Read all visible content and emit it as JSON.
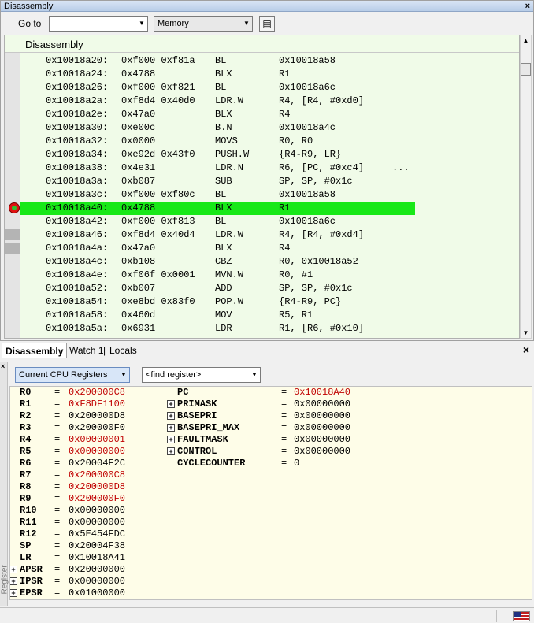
{
  "disassembly_window": {
    "title": "Disassembly",
    "close_glyph": "×",
    "toolbar": {
      "goto_label": "Go to",
      "goto_value": "",
      "memory_select": "Memory",
      "doc_button_icon": "document-icon"
    },
    "header": "Disassembly",
    "lines": [
      {
        "addr": "0x10018a20:",
        "op": "0xf000 0xf81a",
        "mn": "BL",
        "arg": "0x10018a58",
        "extra": ""
      },
      {
        "addr": "0x10018a24:",
        "op": "0x4788",
        "mn": "BLX",
        "arg": "R1",
        "extra": ""
      },
      {
        "addr": "0x10018a26:",
        "op": "0xf000 0xf821",
        "mn": "BL",
        "arg": "0x10018a6c",
        "extra": ""
      },
      {
        "addr": "0x10018a2a:",
        "op": "0xf8d4 0x40d0",
        "mn": "LDR.W",
        "arg": "R4, [R4, #0xd0]",
        "extra": ""
      },
      {
        "addr": "0x10018a2e:",
        "op": "0x47a0",
        "mn": "BLX",
        "arg": "R4",
        "extra": ""
      },
      {
        "addr": "0x10018a30:",
        "op": "0xe00c",
        "mn": "B.N",
        "arg": "0x10018a4c",
        "extra": ""
      },
      {
        "addr": "0x10018a32:",
        "op": "0x0000",
        "mn": "MOVS",
        "arg": "R0, R0",
        "extra": ""
      },
      {
        "addr": "0x10018a34:",
        "op": "0xe92d 0x43f0",
        "mn": "PUSH.W",
        "arg": "{R4-R9, LR}",
        "extra": ""
      },
      {
        "addr": "0x10018a38:",
        "op": "0x4e31",
        "mn": "LDR.N",
        "arg": "R6, [PC, #0xc4]",
        "extra": "..."
      },
      {
        "addr": "0x10018a3a:",
        "op": "0xb087",
        "mn": "SUB",
        "arg": "SP, SP, #0x1c",
        "extra": ""
      },
      {
        "addr": "0x10018a3c:",
        "op": "0xf000 0xf80c",
        "mn": "BL",
        "arg": "0x10018a58",
        "extra": ""
      },
      {
        "addr": "0x10018a40:",
        "op": "0x4788",
        "mn": "BLX",
        "arg": "R1",
        "extra": "",
        "current": true
      },
      {
        "addr": "0x10018a42:",
        "op": "0xf000 0xf813",
        "mn": "BL",
        "arg": "0x10018a6c",
        "extra": ""
      },
      {
        "addr": "0x10018a46:",
        "op": "0xf8d4 0x40d4",
        "mn": "LDR.W",
        "arg": "R4, [R4, #0xd4]",
        "extra": ""
      },
      {
        "addr": "0x10018a4a:",
        "op": "0x47a0",
        "mn": "BLX",
        "arg": "R4",
        "extra": ""
      },
      {
        "addr": "0x10018a4c:",
        "op": "0xb108",
        "mn": "CBZ",
        "arg": "R0, 0x10018a52",
        "extra": ""
      },
      {
        "addr": "0x10018a4e:",
        "op": "0xf06f 0x0001",
        "mn": "MVN.W",
        "arg": "R0, #1",
        "extra": ""
      },
      {
        "addr": "0x10018a52:",
        "op": "0xb007",
        "mn": "ADD",
        "arg": "SP, SP, #0x1c",
        "extra": ""
      },
      {
        "addr": "0x10018a54:",
        "op": "0xe8bd 0x83f0",
        "mn": "POP.W",
        "arg": "{R4-R9, PC}",
        "extra": ""
      },
      {
        "addr": "0x10018a58:",
        "op": "0x460d",
        "mn": "MOV",
        "arg": "R5, R1",
        "extra": ""
      },
      {
        "addr": "0x10018a5a:",
        "op": "0x6931",
        "mn": "LDR",
        "arg": "R1, [R6, #0x10]",
        "extra": ""
      }
    ]
  },
  "tabs": {
    "items": [
      "Disassembly",
      "Watch 1",
      "Locals"
    ],
    "active": "Disassembly",
    "separator": "|",
    "close_glyph": "×"
  },
  "register_window": {
    "side_close_glyph": "×",
    "side_label": "Register",
    "register_group_select": "Current CPU Registers",
    "find_register_placeholder": "<find register>",
    "left_registers": [
      {
        "name": "R0",
        "value": "0x200000C8",
        "changed": true
      },
      {
        "name": "R1",
        "value": "0xF8DF1100",
        "changed": true
      },
      {
        "name": "R2",
        "value": "0x200000D8",
        "changed": false
      },
      {
        "name": "R3",
        "value": "0x200000F0",
        "changed": false
      },
      {
        "name": "R4",
        "value": "0x00000001",
        "changed": true
      },
      {
        "name": "R5",
        "value": "0x00000000",
        "changed": true
      },
      {
        "name": "R6",
        "value": "0x20004F2C",
        "changed": false
      },
      {
        "name": "R7",
        "value": "0x200000C8",
        "changed": true
      },
      {
        "name": "R8",
        "value": "0x200000D8",
        "changed": true
      },
      {
        "name": "R9",
        "value": "0x200000F0",
        "changed": true
      },
      {
        "name": "R10",
        "value": "0x00000000",
        "changed": false
      },
      {
        "name": "R11",
        "value": "0x00000000",
        "changed": false
      },
      {
        "name": "R12",
        "value": "0x5E454FDC",
        "changed": false
      },
      {
        "name": "SP",
        "value": "0x20004F38",
        "changed": false
      },
      {
        "name": "LR",
        "value": "0x10018A41",
        "changed": false
      },
      {
        "name": "APSR",
        "value": "0x20000000",
        "changed": false,
        "expandable": true
      },
      {
        "name": "IPSR",
        "value": "0x00000000",
        "changed": false,
        "expandable": true
      },
      {
        "name": "EPSR",
        "value": "0x01000000",
        "changed": false,
        "expandable": true
      }
    ],
    "right_registers": [
      {
        "name": "PC",
        "value": "0x10018A40",
        "changed": true,
        "expandable": false
      },
      {
        "name": "PRIMASK",
        "value": "0x00000000",
        "changed": false,
        "expandable": true
      },
      {
        "name": "BASEPRI",
        "value": "0x00000000",
        "changed": false,
        "expandable": true
      },
      {
        "name": "BASEPRI_MAX",
        "value": "0x00000000",
        "changed": false,
        "expandable": true
      },
      {
        "name": "FAULTMASK",
        "value": "0x00000000",
        "changed": false,
        "expandable": true
      },
      {
        "name": "CONTROL",
        "value": "0x00000000",
        "changed": false,
        "expandable": true
      },
      {
        "name": "CYCLECOUNTER",
        "value": "0",
        "changed": false,
        "expandable": false
      }
    ],
    "equals": "=",
    "expand_glyph": "+"
  },
  "status_bar": {
    "flag_icon": "us-flag-icon"
  },
  "colors": {
    "changed_value": "#c00000",
    "current_line": "#18e818",
    "code_background": "#f0fbe8",
    "register_background": "#fefde8"
  }
}
